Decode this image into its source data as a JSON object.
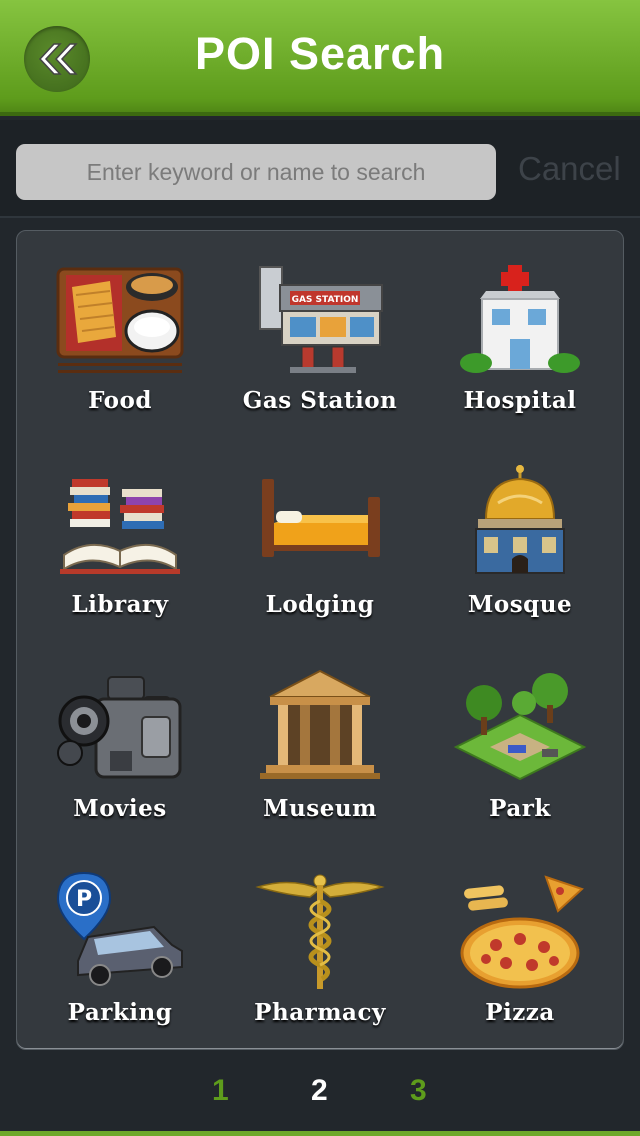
{
  "header": {
    "title": "POI Search",
    "back_icon": "double-chevron-left-icon"
  },
  "search": {
    "placeholder": "Enter keyword or name to search",
    "value": "",
    "cancel_label": "Cancel"
  },
  "categories": [
    {
      "label": "Food",
      "icon": "food-tray-icon"
    },
    {
      "label": "Gas Station",
      "icon": "gas-station-icon"
    },
    {
      "label": "Hospital",
      "icon": "hospital-icon"
    },
    {
      "label": "Library",
      "icon": "books-icon"
    },
    {
      "label": "Lodging",
      "icon": "bed-icon"
    },
    {
      "label": "Mosque",
      "icon": "mosque-icon"
    },
    {
      "label": "Movies",
      "icon": "film-camera-icon"
    },
    {
      "label": "Museum",
      "icon": "museum-icon"
    },
    {
      "label": "Park",
      "icon": "park-icon"
    },
    {
      "label": "Parking",
      "icon": "parking-car-icon"
    },
    {
      "label": "Pharmacy",
      "icon": "caduceus-icon"
    },
    {
      "label": "Pizza",
      "icon": "pizza-icon"
    }
  ],
  "pagination": {
    "pages": [
      "1",
      "2",
      "3"
    ],
    "current": "2",
    "active_color": "#ffffff",
    "inactive_color": "#5e9c1c"
  },
  "colors": {
    "accent": "#6ea82a",
    "background": "#22272c",
    "panel": "#34393e"
  }
}
